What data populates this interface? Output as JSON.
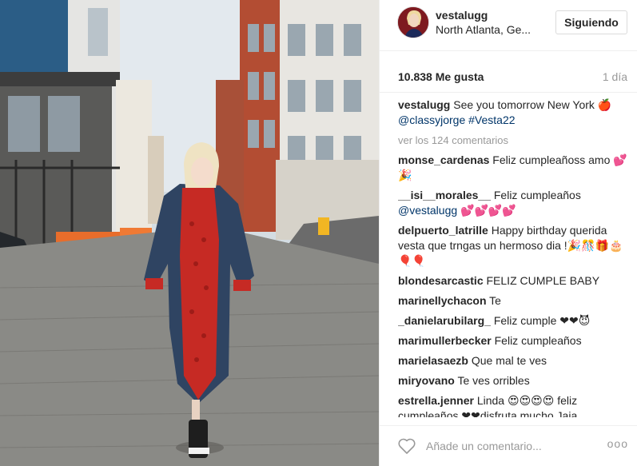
{
  "post": {
    "username": "vestalugg",
    "location": "North Atlanta, Ge...",
    "follow_label": "Siguiendo",
    "likes": "10.838 Me gusta",
    "age": "1 día",
    "caption_text": "See you tomorrow New York 🍎",
    "caption_links": "@classyjorge #Vesta22",
    "view_comments": "ver los 124 comentarios",
    "add_comment_placeholder": "Añade un comentario...",
    "more_label": "ooo"
  },
  "comments": [
    {
      "user": "monse_cardenas",
      "text": "Feliz cumpleañoss amo 💕🎉"
    },
    {
      "user": "__isi__morales__",
      "text": "Feliz cumpleaños",
      "link": "@vestalugg 💕💕💕💕"
    },
    {
      "user": "delpuerto_latrille",
      "text": "Happy birthday querida vesta que trngas un hermoso dia !🎉🎊🎁🎂🎈🎈"
    },
    {
      "user": "blondesarcastic",
      "text": "FELIZ CUMPLE BABY"
    },
    {
      "user": "marinellychacon",
      "text": "Te"
    },
    {
      "user": "_danielarubilarg_",
      "text": "Feliz cumple ❤❤😈"
    },
    {
      "user": "marimullerbecker",
      "text": "Feliz cumpleaños"
    },
    {
      "user": "marielasaezb",
      "text": "Que mal te ves"
    },
    {
      "user": "miryovano",
      "text": "Te ves orribles"
    },
    {
      "user": "estrella.jenner",
      "text": "Linda 😍😍😍😍 feliz cumpleaños ❤❤disfruta mucho Jaja"
    }
  ],
  "colors": {
    "accent_link": "#003569",
    "muted": "#999999",
    "border": "#efefef"
  },
  "icons": {
    "like": "heart-icon",
    "more": "more-options-icon"
  }
}
